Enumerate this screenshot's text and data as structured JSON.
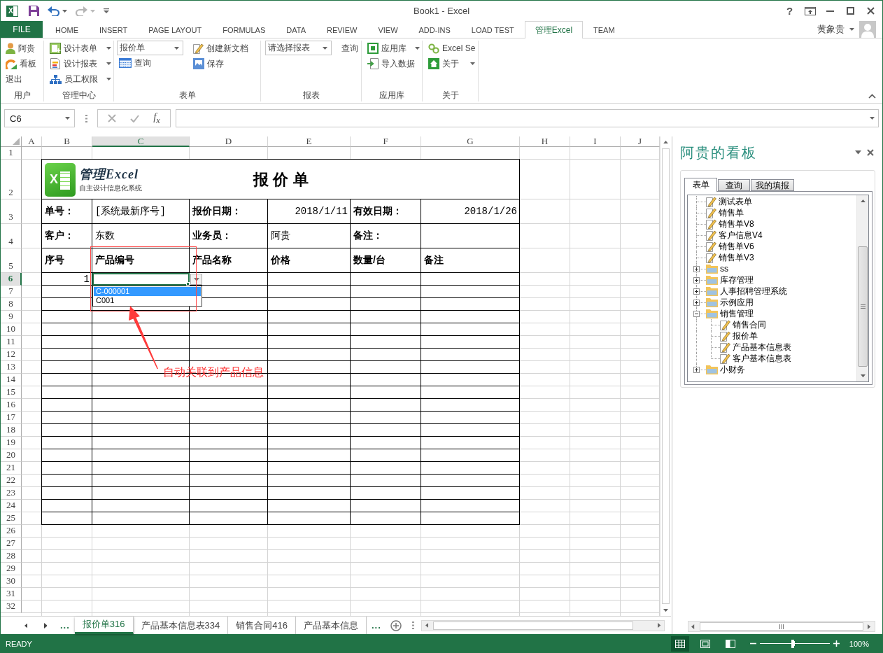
{
  "window": {
    "icon_letter": "X",
    "title": "Book1 - Excel",
    "help": "?"
  },
  "ribbon_tabs": [
    {
      "label": "FILE",
      "kind": "file",
      "selected": false
    },
    {
      "label": "HOME",
      "kind": "tab",
      "selected": false
    },
    {
      "label": "INSERT",
      "kind": "tab",
      "selected": false
    },
    {
      "label": "PAGE LAYOUT",
      "kind": "tab",
      "selected": false
    },
    {
      "label": "FORMULAS",
      "kind": "tab",
      "selected": false
    },
    {
      "label": "DATA",
      "kind": "tab",
      "selected": false
    },
    {
      "label": "REVIEW",
      "kind": "tab",
      "selected": false
    },
    {
      "label": "VIEW",
      "kind": "tab",
      "selected": false
    },
    {
      "label": "ADD-INS",
      "kind": "tab",
      "selected": false
    },
    {
      "label": "LOAD TEST",
      "kind": "tab",
      "selected": false
    },
    {
      "label": "管理Excel",
      "kind": "tab",
      "selected": true
    },
    {
      "label": "TEAM",
      "kind": "tab",
      "selected": false
    }
  ],
  "account": {
    "name": "黄象贵"
  },
  "ribbon_groups": [
    {
      "label": "用户",
      "columns": [
        {
          "kind": "stack",
          "items": [
            {
              "kind": "button",
              "label": "阿贵"
            },
            {
              "kind": "button",
              "label": "看板"
            },
            {
              "kind": "button",
              "label": "退出"
            }
          ]
        }
      ]
    },
    {
      "label": "管理中心",
      "columns": [
        {
          "kind": "stack",
          "items": [
            {
              "kind": "menu",
              "label": "设计表单"
            },
            {
              "kind": "menu",
              "label": "设计报表"
            },
            {
              "kind": "menu",
              "label": "员工权限"
            }
          ]
        }
      ]
    },
    {
      "label": "表单",
      "columns": [
        {
          "kind": "stack",
          "items": [
            {
              "kind": "combo",
              "label": "报价单"
            },
            {
              "kind": "button",
              "label": "查询"
            }
          ]
        },
        {
          "kind": "separator"
        },
        {
          "kind": "stack",
          "items": [
            {
              "kind": "button",
              "label": "创建新文档"
            },
            {
              "kind": "button",
              "label": "保存"
            }
          ]
        },
        {
          "kind": "separator"
        }
      ]
    },
    {
      "label": "报表",
      "columns": [
        {
          "kind": "stack",
          "items": [
            {
              "kind": "combo",
              "label": "请选择报表"
            }
          ]
        },
        {
          "kind": "separator"
        },
        {
          "kind": "stack",
          "items": [
            {
              "kind": "button",
              "label": "查询"
            }
          ]
        }
      ]
    },
    {
      "label": "应用库",
      "columns": [
        {
          "kind": "stack",
          "items": [
            {
              "kind": "menu",
              "label": "应用库"
            },
            {
              "kind": "button",
              "label": "导入数据"
            }
          ]
        }
      ]
    },
    {
      "label": "关于",
      "columns": [
        {
          "kind": "stack",
          "items": [
            {
              "kind": "button",
              "label": "Excel Se"
            },
            {
              "kind": "menu",
              "label": "关于"
            }
          ]
        }
      ]
    }
  ],
  "formula_bar": {
    "name_box": "C6",
    "insert_function": "f$_{x}$"
  },
  "sheet": {
    "column_headers": [
      {
        "label": "A",
        "selected": false
      },
      {
        "label": "B",
        "selected": false
      },
      {
        "label": "C",
        "selected": true
      },
      {
        "label": "D",
        "selected": false
      },
      {
        "label": "E",
        "selected": false
      },
      {
        "label": "F",
        "selected": false
      },
      {
        "label": "G",
        "selected": false
      },
      {
        "label": "H",
        "selected": false
      },
      {
        "label": "I",
        "selected": false
      },
      {
        "label": "J",
        "selected": false
      }
    ],
    "row_headers": [
      {
        "label": "1",
        "selected": false
      },
      {
        "label": "2",
        "selected": false
      },
      {
        "label": "3",
        "selected": false
      },
      {
        "label": "4",
        "selected": false
      },
      {
        "label": "5",
        "selected": false
      },
      {
        "label": "6",
        "selected": true
      },
      {
        "label": "7",
        "selected": false
      },
      {
        "label": "8",
        "selected": false
      },
      {
        "label": "9",
        "selected": false
      },
      {
        "label": "10",
        "selected": false
      },
      {
        "label": "11",
        "selected": false
      },
      {
        "label": "12",
        "selected": false
      },
      {
        "label": "13",
        "selected": false
      },
      {
        "label": "14",
        "selected": false
      },
      {
        "label": "15",
        "selected": false
      },
      {
        "label": "16",
        "selected": false
      },
      {
        "label": "17",
        "selected": false
      },
      {
        "label": "18",
        "selected": false
      },
      {
        "label": "19",
        "selected": false
      },
      {
        "label": "20",
        "selected": false
      },
      {
        "label": "21",
        "selected": false
      },
      {
        "label": "22",
        "selected": false
      },
      {
        "label": "23",
        "selected": false
      },
      {
        "label": "24",
        "selected": false
      },
      {
        "label": "25",
        "selected": false
      },
      {
        "label": "26",
        "selected": false
      },
      {
        "label": "27",
        "selected": false
      },
      {
        "label": "28",
        "selected": false
      },
      {
        "label": "29",
        "selected": false
      },
      {
        "label": "30",
        "selected": false
      },
      {
        "label": "31",
        "selected": false
      },
      {
        "label": "32",
        "selected": false
      }
    ],
    "form": {
      "logo": {
        "letter": "X",
        "brand": "管理Excel",
        "tagline": "自主设计信息化系统"
      },
      "title": "报 价 单",
      "rows": [
        [
          {
            "kind": "label",
            "text": "单号："
          },
          {
            "kind": "value",
            "text": "[系统最新序号]"
          },
          {
            "kind": "label",
            "text": "报价日期："
          },
          {
            "kind": "number",
            "text": "2018/1/11"
          },
          {
            "kind": "label",
            "text": "有效日期："
          },
          {
            "kind": "number",
            "text": "2018/1/26"
          }
        ],
        [
          {
            "kind": "label",
            "text": "客户："
          },
          {
            "kind": "value",
            "text": "东数"
          },
          {
            "kind": "label",
            "text": "业务员："
          },
          {
            "kind": "value",
            "text": "阿贵"
          },
          {
            "kind": "label",
            "text": "备注："
          },
          {
            "kind": "empty"
          }
        ],
        [
          {
            "kind": "label",
            "text": "序号"
          },
          {
            "kind": "label",
            "text": "产品编号"
          },
          {
            "kind": "label",
            "text": "产品名称"
          },
          {
            "kind": "label",
            "text": "价格"
          },
          {
            "kind": "label",
            "text": "数量/台"
          },
          {
            "kind": "label",
            "text": "备注"
          }
        ]
      ],
      "line_items": [
        {
          "number": "1"
        }
      ]
    },
    "cell_dropdown": {
      "options": [
        {
          "label": "C-000001",
          "selected": true
        },
        {
          "label": "C001",
          "selected": false
        }
      ]
    },
    "annotation": {
      "text": "自动关联到产品信息"
    }
  },
  "sheet_tabs": {
    "more_left": "...",
    "tabs": [
      {
        "label": "报价单316",
        "selected": true
      },
      {
        "label": "产品基本信息表334",
        "selected": false
      },
      {
        "label": "销售合同416",
        "selected": false
      },
      {
        "label": "产品基本信息",
        "selected": false
      }
    ],
    "more_right": "..."
  },
  "task_pane": {
    "title": "阿贵的看板",
    "tabs": [
      {
        "label": "表单",
        "selected": true
      },
      {
        "label": "查询",
        "selected": false
      },
      {
        "label": "我的填报",
        "selected": false
      }
    ],
    "tree": [
      {
        "kind": "form",
        "label": "测试表单"
      },
      {
        "kind": "form",
        "label": "销售单"
      },
      {
        "kind": "form",
        "label": "销售单V8"
      },
      {
        "kind": "form",
        "label": "客户信息V4"
      },
      {
        "kind": "form",
        "label": "销售单V6"
      },
      {
        "kind": "form",
        "label": "销售单V3"
      },
      {
        "kind": "folder",
        "label": "ss",
        "expanded": false
      },
      {
        "kind": "folder",
        "label": "库存管理",
        "expanded": false
      },
      {
        "kind": "folder",
        "label": "人事招聘管理系统",
        "expanded": false
      },
      {
        "kind": "folder",
        "label": "示例应用",
        "expanded": false
      },
      {
        "kind": "folder",
        "label": "销售管理",
        "expanded": true,
        "children": [
          {
            "kind": "form",
            "label": "销售合同"
          },
          {
            "kind": "form",
            "label": "报价单"
          },
          {
            "kind": "form",
            "label": "产品基本信息表"
          },
          {
            "kind": "form",
            "label": "客户基本信息表"
          }
        ]
      },
      {
        "kind": "folder",
        "label": "小财务",
        "expanded": false
      }
    ]
  },
  "status_bar": {
    "status": "READY",
    "views": [
      {
        "kind": "normal",
        "selected": true
      },
      {
        "kind": "page_layout",
        "selected": false
      },
      {
        "kind": "page_break",
        "selected": false
      }
    ],
    "zoom": {
      "level": 0.47,
      "reading": "100%"
    }
  }
}
